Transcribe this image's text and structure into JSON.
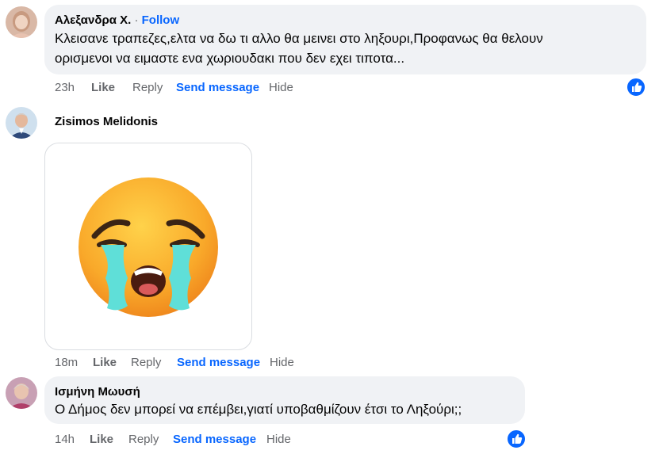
{
  "comments": [
    {
      "author": "Αλεξανδρα Χ.",
      "separator": "·",
      "follow_label": "Follow",
      "text_line1": "Κλεισανε τραπεζες,ελτα να δω τι αλλο θα μεινει στο ληξουρι,Προφανως θα θελουν",
      "text_line2": "ορισμενοι να ειμαστε ενα χωριουδακι που δεν εχει τιποτα...",
      "time": "23h",
      "like": "Like",
      "reply": "Reply",
      "send": "Send message",
      "hide": "Hide",
      "reaction": "like-icon"
    },
    {
      "author": "Zisimos Melidonis",
      "sticker": "loudly-crying-face",
      "time": "18m",
      "like": "Like",
      "reply": "Reply",
      "send": "Send message",
      "hide": "Hide"
    },
    {
      "author": "Ισμήνη Μωυσή",
      "text_line1": "Ο Δήμος δεν μπορεί να επέμβει,γιατί υποβαθμίζουν έτσι το Ληξούρι;;",
      "time": "14h",
      "like": "Like",
      "reply": "Reply",
      "send": "Send message",
      "hide": "Hide",
      "reaction": "like-icon"
    }
  ],
  "colors": {
    "link": "#0866ff",
    "muted": "#65676b",
    "bubble": "#f0f2f5",
    "tear": "#5fdfd8",
    "face": "#fbb032"
  }
}
